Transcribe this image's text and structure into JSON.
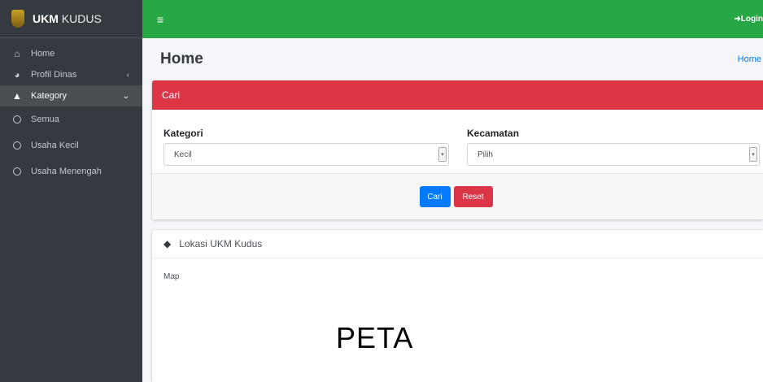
{
  "brand": {
    "bold": "UKM",
    "rest": " KUDUS"
  },
  "sidebar": {
    "items": [
      {
        "icon": "home-icon",
        "glyph": "⌂",
        "label": "Home",
        "active": false
      },
      {
        "icon": "pie-chart-icon",
        "glyph": "◕",
        "label": "Profil Dinas",
        "caret": "‹",
        "active": false
      },
      {
        "icon": "tree-icon",
        "glyph": "▲",
        "label": "Kategory",
        "caret": "⌄",
        "active": true
      },
      {
        "label": "Semua"
      },
      {
        "label": "Usaha Kecil"
      },
      {
        "label": "Usaha Menengah"
      }
    ]
  },
  "topbar": {
    "menu_glyph": "≡",
    "login": "➜Login"
  },
  "header": {
    "title": "Home",
    "breadcrumb": "Home"
  },
  "search_card": {
    "title": "Cari",
    "kategori": {
      "label": "Kategori",
      "value": "Kecil"
    },
    "kecamatan": {
      "label": "Kecamatan",
      "value": "Pilih"
    },
    "cari_button": "Cari",
    "reset_button": "Reset"
  },
  "map_card": {
    "title": "Lokasi UKM Kudus",
    "subtitle": "Map",
    "placeholder": "PETA"
  },
  "colors": {
    "topbar": "#28a745",
    "sidebar": "#343a40",
    "danger": "#dc3545",
    "primary": "#007bff"
  }
}
